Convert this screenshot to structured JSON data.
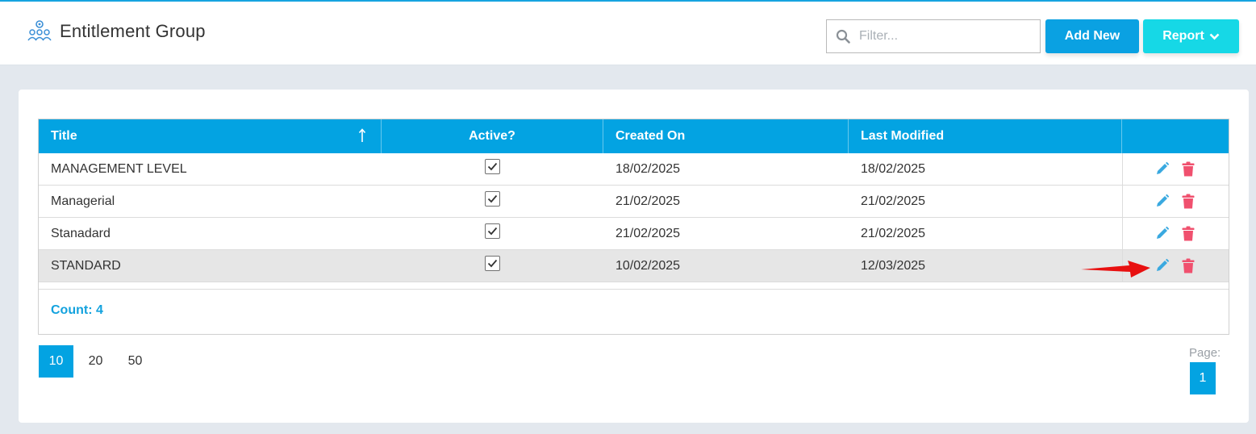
{
  "header": {
    "title": "Entitlement Group",
    "filter_placeholder": "Filter...",
    "add_new_label": "Add New",
    "report_label": "Report"
  },
  "table": {
    "columns": [
      "Title",
      "Active?",
      "Created On",
      "Last Modified"
    ],
    "rows": [
      {
        "title": "MANAGEMENT LEVEL",
        "active": true,
        "created_on": "18/02/2025",
        "last_modified": "18/02/2025"
      },
      {
        "title": "Managerial",
        "active": true,
        "created_on": "21/02/2025",
        "last_modified": "21/02/2025"
      },
      {
        "title": "Stanadard",
        "active": true,
        "created_on": "21/02/2025",
        "last_modified": "21/02/2025"
      },
      {
        "title": "STANDARD",
        "active": true,
        "created_on": "10/02/2025",
        "last_modified": "12/03/2025",
        "highlighted": true
      }
    ],
    "count_text": "Count: 4"
  },
  "pager": {
    "page_sizes": [
      "10",
      "20",
      "50"
    ],
    "active_size": "10",
    "page_label": "Page:",
    "current_page": "1"
  },
  "colors": {
    "primary": "#03a3e2",
    "report": "#16d8e6",
    "edit": "#3aa9e0",
    "delete": "#f0506e",
    "annotation_arrow": "#e81010"
  },
  "icons": {
    "page": "group-settings-icon",
    "filter": "search-icon",
    "sort": "sort-ascending-icon",
    "edit": "pencil-icon",
    "delete": "trash-icon"
  }
}
